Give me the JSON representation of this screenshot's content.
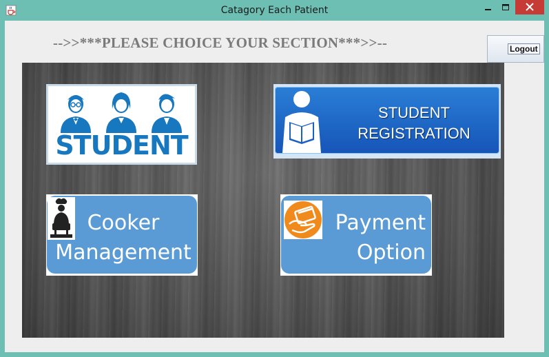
{
  "window": {
    "title": "Catagory Each Patient",
    "app_icon": "java-cup-icon",
    "controls": [
      "minimize-icon",
      "maximize-icon",
      "close-icon"
    ],
    "close_color": "#c73b37",
    "frame_color": "#6dbfb3"
  },
  "header": {
    "heading": "-->>***PLEASE CHOICE YOUR SECTION***>>--",
    "logout_label": "Logout"
  },
  "tiles": {
    "student": {
      "label": "STUDENT",
      "icon": "three-students-icon",
      "color": "#1778c0"
    },
    "registration": {
      "line1": "STUDENT",
      "line2": "REGISTRATION",
      "icon": "person-reading-icon",
      "color": "#1f6fd0"
    },
    "cooker": {
      "line1": "Cooker",
      "line2": "Management",
      "icon": "chef-cooking-icon",
      "color": "#5b9bd5"
    },
    "payment": {
      "line1": "Payment",
      "line2": "Option",
      "icon": "credit-card-hand-icon",
      "accent": "#f08a1c"
    }
  }
}
